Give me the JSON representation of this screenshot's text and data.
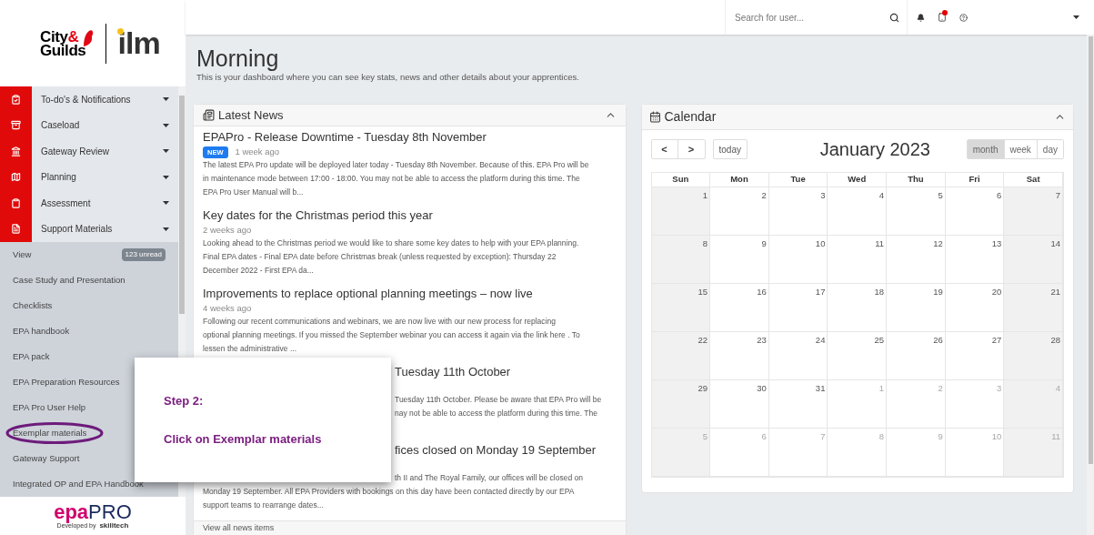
{
  "logo": {
    "city": "City",
    "amp": "&",
    "guilds": "Guilds",
    "ilm": "ilm"
  },
  "nav": [
    {
      "label": "To-do's & Notifications"
    },
    {
      "label": "Caseload"
    },
    {
      "label": "Gateway Review"
    },
    {
      "label": "Planning"
    },
    {
      "label": "Assessment"
    },
    {
      "label": "Support Materials"
    }
  ],
  "submenu": [
    {
      "label": "View",
      "badge": "123 unread",
      "circled": false
    },
    {
      "label": "Case Study and Presentation",
      "circled": false
    },
    {
      "label": "Checklists",
      "circled": false
    },
    {
      "label": "EPA handbook",
      "circled": false
    },
    {
      "label": "EPA pack",
      "circled": false
    },
    {
      "label": "EPA Preparation Resources",
      "circled": false
    },
    {
      "label": "EPA Pro User Help",
      "circled": false
    },
    {
      "label": "Exemplar materials",
      "circled": true
    },
    {
      "label": "Gateway Support",
      "circled": false
    },
    {
      "label": "Integrated OP and EPA Handbook",
      "circled": false
    }
  ],
  "footer_logo": {
    "epa": "epa",
    "pro": "PRO",
    "credit": "Developed by",
    "maker": "skilltech"
  },
  "header": {
    "search_placeholder": "Search for user...",
    "notification_dot": true
  },
  "page": {
    "title": "Morning",
    "subtitle": "This is your dashboard where you can see key stats, news and other details about your apprentices."
  },
  "news": {
    "title": "Latest News",
    "footer_link": "View all news items",
    "items": [
      {
        "kind": "full",
        "title": "EPAPro - Release Downtime - Tuesday 8th November",
        "badge": "NEW",
        "time": "1 week ago",
        "lines": [
          "The latest EPA Pro update will be deployed later today - Tuesday 8th November. Because of this. EPA Pro will be",
          "in maintenance mode between 17:00 - 18:00. You may not be able to access the platform during this time.  The",
          "EPA Pro User Manual will b..."
        ]
      },
      {
        "kind": "full",
        "title": "Key dates for the Christmas period this year",
        "time": "2 weeks ago",
        "lines": [
          "Looking ahead to the Christmas period we would like to share some key dates to help with your EPA planning.",
          "Final EPA dates - Final EPA date before Christmas break (unless requested by exception):  Thursday 22",
          "December 2022 - First EPA da..."
        ]
      },
      {
        "kind": "full",
        "title": "Improvements to replace optional planning meetings – now live",
        "time": "4 weeks ago",
        "lines": [
          "Following our recent communications and webinars, we are now live with our new process for replacing",
          "optional planning meetings.  If you missed the September webinar you can access it again via the link here .   To",
          "lessen the administrative ..."
        ]
      },
      {
        "kind": "partly_covered",
        "title": "Tuesday 11th October",
        "tail_lines": [
          "Tuesday 11th October. Please be aware that EPA Pro will be",
          "nay not be able to access the platform during this time. The"
        ]
      },
      {
        "kind": "partly_covered",
        "title": "fices closed on Monday 19 September",
        "tail_lines": [
          "th II and The Royal Family, our offices will be closed on"
        ],
        "lines": [
          "Monday 19 September. All EPA Providers with bookings on this day have been contacted directly by our EPA",
          "support teams to rearrange dates..."
        ]
      }
    ]
  },
  "calendar": {
    "title": "Calendar",
    "prev": "<",
    "next": ">",
    "today": "today",
    "month_title": "January 2023",
    "views": [
      {
        "label": "month",
        "selected": true
      },
      {
        "label": "week",
        "selected": false
      },
      {
        "label": "day",
        "selected": false
      }
    ],
    "weekdays": [
      "Sun",
      "Mon",
      "Tue",
      "Wed",
      "Thu",
      "Fri",
      "Sat"
    ],
    "weeks": [
      [
        {
          "day": "1",
          "other_month": false
        },
        {
          "day": "2",
          "other_month": false
        },
        {
          "day": "3",
          "other_month": false
        },
        {
          "day": "4",
          "other_month": false
        },
        {
          "day": "5",
          "other_month": false
        },
        {
          "day": "6",
          "other_month": false
        },
        {
          "day": "7",
          "other_month": false
        }
      ],
      [
        {
          "day": "8",
          "other_month": false
        },
        {
          "day": "9",
          "other_month": false
        },
        {
          "day": "10",
          "other_month": false
        },
        {
          "day": "11",
          "other_month": false
        },
        {
          "day": "12",
          "other_month": false
        },
        {
          "day": "13",
          "other_month": false
        },
        {
          "day": "14",
          "other_month": false
        }
      ],
      [
        {
          "day": "15",
          "other_month": false
        },
        {
          "day": "16",
          "other_month": false
        },
        {
          "day": "17",
          "other_month": false
        },
        {
          "day": "18",
          "other_month": false
        },
        {
          "day": "19",
          "other_month": false
        },
        {
          "day": "20",
          "other_month": false
        },
        {
          "day": "21",
          "other_month": false
        }
      ],
      [
        {
          "day": "22",
          "other_month": false
        },
        {
          "day": "23",
          "other_month": false
        },
        {
          "day": "24",
          "other_month": false
        },
        {
          "day": "25",
          "other_month": false
        },
        {
          "day": "26",
          "other_month": false
        },
        {
          "day": "27",
          "other_month": false
        },
        {
          "day": "28",
          "other_month": false
        }
      ],
      [
        {
          "day": "29",
          "other_month": false
        },
        {
          "day": "30",
          "other_month": false
        },
        {
          "day": "31",
          "other_month": false
        },
        {
          "day": "1",
          "other_month": true
        },
        {
          "day": "2",
          "other_month": true
        },
        {
          "day": "3",
          "other_month": true
        },
        {
          "day": "4",
          "other_month": true
        }
      ],
      [
        {
          "day": "5",
          "other_month": true
        },
        {
          "day": "6",
          "other_month": true
        },
        {
          "day": "7",
          "other_month": true
        },
        {
          "day": "8",
          "other_month": true
        },
        {
          "day": "9",
          "other_month": true
        },
        {
          "day": "10",
          "other_month": true
        },
        {
          "day": "11",
          "other_month": true
        }
      ]
    ]
  },
  "callout": {
    "step": "Step 2:",
    "instruction": "Click on Exemplar materials"
  }
}
